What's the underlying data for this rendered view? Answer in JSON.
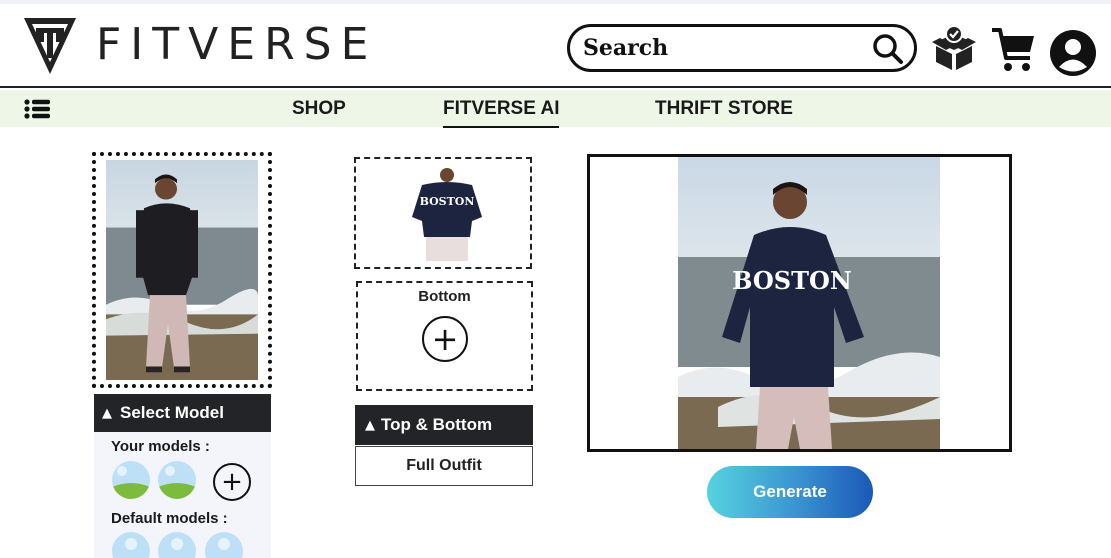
{
  "brand": {
    "name": "FITVERSE",
    "logo_icon": "fitverse-logo-icon"
  },
  "search": {
    "placeholder": "Search",
    "icon": "search-icon"
  },
  "header_icons": [
    "box-check-icon",
    "cart-icon",
    "user-icon"
  ],
  "nav": {
    "menu_icon": "menu-list-icon",
    "items": [
      {
        "label": "SHOP",
        "active": false
      },
      {
        "label": "FITVERSE AI",
        "active": true
      },
      {
        "label": "THRIFT STORE",
        "active": false
      }
    ]
  },
  "model_panel": {
    "select_label": "Select Model",
    "your_models_label": "Your models :",
    "default_models_label": "Default models :"
  },
  "outfit_panel": {
    "top_garment_text": "BOSTON",
    "bottom_label": "Bottom",
    "dropdown_label": "Top & Bottom",
    "option_label": "Full Outfit"
  },
  "result": {
    "shirt_text": "BOSTON"
  },
  "actions": {
    "generate_label": "Generate"
  },
  "colors": {
    "nav_bg": "#eef7e7",
    "dark_bar": "#222428",
    "panel_bg": "#f3f5fb",
    "generate_start": "#56d3df",
    "generate_end": "#1b58b8",
    "shirt_navy": "#1c2440"
  }
}
